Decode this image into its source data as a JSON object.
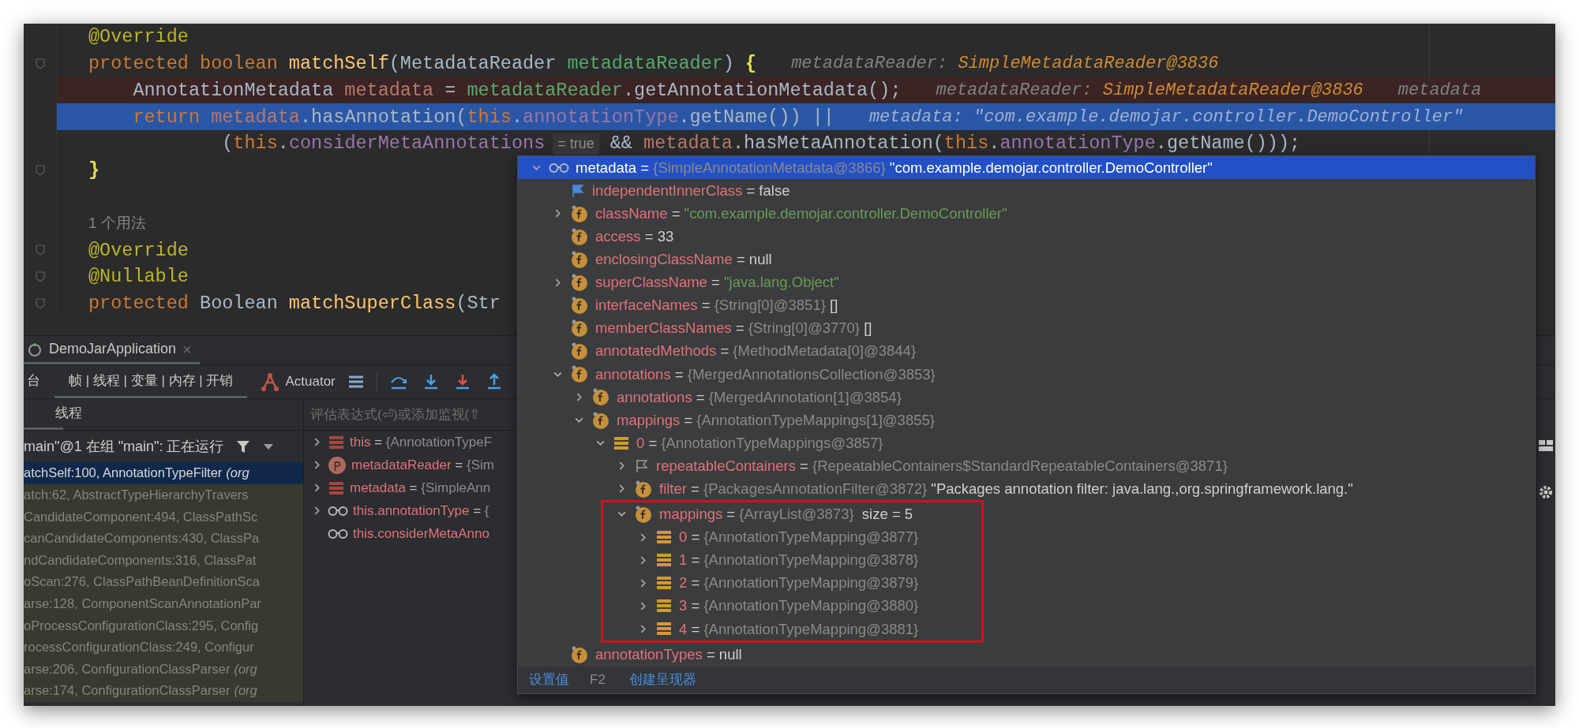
{
  "editor": {
    "lines": [
      {
        "kind": "normal",
        "items": [
          {
            "kind": "code",
            "tokens": [
              {
                "kind": "annotation",
                "text": "@Override"
              }
            ]
          }
        ]
      },
      {
        "kind": "normal",
        "fold_marker": true,
        "items": [
          {
            "kind": "code",
            "tokens": [
              {
                "kind": "keyword",
                "text": "protected boolean "
              },
              {
                "kind": "method",
                "text": "matchSelf"
              },
              {
                "kind": "plain",
                "text": "(MetadataReader "
              },
              {
                "kind": "param",
                "text": "metadataReader"
              },
              {
                "kind": "plain",
                "text": ") "
              },
              {
                "kind": "brace",
                "text": "{"
              }
            ]
          },
          {
            "kind": "hint",
            "tokens": [
              {
                "kind": "label",
                "text": "metadataReader: "
              },
              {
                "kind": "value",
                "text": "SimpleMetadataReader@3836"
              }
            ]
          }
        ]
      },
      {
        "kind": "breakpoint",
        "items": [
          {
            "kind": "code",
            "tokens": [
              {
                "kind": "plain",
                "text": "    AnnotationMetadata "
              },
              {
                "kind": "local",
                "text": "metadata"
              },
              {
                "kind": "plain",
                "text": " = "
              },
              {
                "kind": "param",
                "text": "metadataReader"
              },
              {
                "kind": "plain",
                "text": ".getAnnotationMetadata();"
              }
            ]
          },
          {
            "kind": "hint",
            "tokens": [
              {
                "kind": "label",
                "text": "metadataReader: "
              },
              {
                "kind": "value",
                "text": "SimpleMetadataReader@3836"
              }
            ]
          },
          {
            "kind": "hint",
            "tokens": [
              {
                "kind": "label",
                "text": "metadata"
              }
            ]
          }
        ]
      },
      {
        "kind": "current",
        "items": [
          {
            "kind": "code",
            "tokens": [
              {
                "kind": "keyword",
                "text": "    return "
              },
              {
                "kind": "local",
                "text": "metadata"
              },
              {
                "kind": "plain",
                "text": ".hasAnnotation("
              },
              {
                "kind": "keyword",
                "text": "this"
              },
              {
                "kind": "plain",
                "text": "."
              },
              {
                "kind": "field",
                "text": "annotationType"
              },
              {
                "kind": "plain",
                "text": ".getName()) ||"
              }
            ]
          },
          {
            "kind": "hint",
            "tokens": [
              {
                "kind": "label",
                "text": "metadata: \"com.example.demojar.controller.DemoController\""
              }
            ]
          }
        ]
      },
      {
        "kind": "normal",
        "items": [
          {
            "kind": "code",
            "tokens": [
              {
                "kind": "plain",
                "text": "            ("
              },
              {
                "kind": "keyword",
                "text": "this"
              },
              {
                "kind": "plain",
                "text": "."
              },
              {
                "kind": "field",
                "text": "considerMetaAnnotations"
              }
            ]
          },
          {
            "kind": "inlay",
            "text": "= true"
          },
          {
            "kind": "code",
            "tokens": [
              {
                "kind": "plain",
                "text": "&& "
              },
              {
                "kind": "local",
                "text": "metadata"
              },
              {
                "kind": "plain",
                "text": ".hasMetaAnnotation("
              },
              {
                "kind": "keyword",
                "text": "this"
              },
              {
                "kind": "plain",
                "text": "."
              },
              {
                "kind": "field",
                "text": "annotationType"
              },
              {
                "kind": "plain",
                "text": ".getName()));"
              }
            ]
          }
        ]
      },
      {
        "kind": "normal",
        "fold_marker": true,
        "items": [
          {
            "kind": "code",
            "tokens": [
              {
                "kind": "brace",
                "text": "}"
              }
            ]
          }
        ]
      },
      {
        "kind": "normal"
      },
      {
        "kind": "normal",
        "items": [
          {
            "kind": "usage",
            "text": "1 个用法"
          }
        ]
      },
      {
        "kind": "normal",
        "fold_marker": true,
        "items": [
          {
            "kind": "code",
            "tokens": [
              {
                "kind": "annotation",
                "text": "@Override"
              }
            ]
          }
        ]
      },
      {
        "kind": "normal",
        "fold_marker": true,
        "items": [
          {
            "kind": "code",
            "tokens": [
              {
                "kind": "annotation",
                "text": "@Nullable"
              }
            ]
          }
        ]
      },
      {
        "kind": "normal",
        "fold_marker": true,
        "items": [
          {
            "kind": "code",
            "tokens": [
              {
                "kind": "keyword",
                "text": "protected "
              },
              {
                "kind": "plain",
                "text": "Boolean "
              },
              {
                "kind": "method",
                "text": "matchSuperClass"
              },
              {
                "kind": "plain",
                "text": "(Str"
              }
            ]
          }
        ]
      }
    ]
  },
  "debug_panel": {
    "run_tab": {
      "label": "DemoJarApplication",
      "close": "×"
    },
    "toolbar_tabs": [
      {
        "label": "台",
        "selected": false
      },
      {
        "label": "帧 | 线程 | 变量 | 内存 | 开销",
        "selected": true
      }
    ],
    "actuator": "Actuator",
    "threads_tab": {
      "label": "线程",
      "selected": true
    },
    "thread_selector": "main\"@1 在组 \"main\": 正在运行",
    "frames": [
      {
        "text": "atchSelf:100, AnnotationTypeFilter *(org*",
        "selected": true
      },
      {
        "text": "atch:62, AbstractTypeHierarchyTravers",
        "selected": false
      },
      {
        "text": "CandidateComponent:494, ClassPathSc",
        "selected": false
      },
      {
        "text": "canCandidateComponents:430, ClassPa",
        "selected": false
      },
      {
        "text": "ndCandidateComponents:316, ClassPat",
        "selected": false
      },
      {
        "text": "oScan:276, ClassPathBeanDefinitionSca",
        "selected": false
      },
      {
        "text": "arse:128, ComponentScanAnnotationPar",
        "selected": false
      },
      {
        "text": "oProcessConfigurationClass:295, Config",
        "selected": false
      },
      {
        "text": "rocessConfigurationClass:249, Configur",
        "selected": false
      },
      {
        "text": "arse:206, ConfigurationClassParser *(org*",
        "selected": false
      },
      {
        "text": "arse:174, ConfigurationClassParser *(org*",
        "selected": false
      }
    ],
    "evaluate": {
      "placeholder": "评估表达式(⏎)或添加监视(⇧"
    },
    "variables": [
      {
        "kind": "object",
        "name": "this",
        "value": [
          {
            "kind": "plain",
            "text": " = "
          },
          {
            "kind": "ref",
            "text": "{AnnotationTypeF"
          }
        ],
        "expanded": false
      },
      {
        "kind": "param",
        "name": "metadataReader",
        "value": [
          {
            "kind": "plain",
            "text": " = "
          },
          {
            "kind": "ref",
            "text": "{Sim"
          }
        ],
        "expanded": false
      },
      {
        "kind": "object",
        "name": "metadata",
        "value": [
          {
            "kind": "plain",
            "text": " = "
          },
          {
            "kind": "ref",
            "text": "{SimpleAnn"
          }
        ],
        "expanded": false
      },
      {
        "kind": "watch",
        "name": "this.annotationType",
        "value": [
          {
            "kind": "plain",
            "text": " = "
          },
          {
            "kind": "ref",
            "text": "{"
          }
        ],
        "expanded": false
      },
      {
        "kind": "watch",
        "name": "this.considerMetaAnno"
      }
    ]
  },
  "popup": {
    "root": {
      "kind": "watch",
      "name": "metadata",
      "value": [
        {
          "kind": "plain",
          "text": " = "
        },
        {
          "kind": "ref",
          "text": "{SimpleAnnotationMetadata@3866}"
        },
        {
          "kind": "plain",
          "text": " \"com.example.demojar.controller.DemoController\""
        }
      ],
      "expanded": true,
      "selected": true,
      "children": [
        {
          "kind": "flag",
          "name": "independentInnerClass",
          "value": [
            {
              "kind": "plain",
              "text": " = false"
            }
          ],
          "selected": false
        },
        {
          "kind": "field",
          "name": "className",
          "value": [
            {
              "kind": "plain",
              "text": " = "
            },
            {
              "kind": "string",
              "text": "\"com.example.demojar.controller.DemoController\""
            }
          ],
          "expanded": false,
          "selected": false
        },
        {
          "kind": "field",
          "name": "access",
          "value": [
            {
              "kind": "plain",
              "text": " = 33"
            }
          ],
          "selected": false
        },
        {
          "kind": "field",
          "name": "enclosingClassName",
          "value": [
            {
              "kind": "plain",
              "text": " = null"
            }
          ],
          "selected": false
        },
        {
          "kind": "field",
          "name": "superClassName",
          "value": [
            {
              "kind": "plain",
              "text": " = "
            },
            {
              "kind": "string",
              "text": "\"java.lang.Object\""
            }
          ],
          "expanded": false,
          "selected": false
        },
        {
          "kind": "field",
          "name": "interfaceNames",
          "value": [
            {
              "kind": "plain",
              "text": " = "
            },
            {
              "kind": "ref",
              "text": "{String[0]@3851}"
            },
            {
              "kind": "plain",
              "text": " []"
            }
          ],
          "selected": false
        },
        {
          "kind": "field",
          "name": "memberClassNames",
          "value": [
            {
              "kind": "plain",
              "text": " = "
            },
            {
              "kind": "ref",
              "text": "{String[0]@3770}"
            },
            {
              "kind": "plain",
              "text": " []"
            }
          ],
          "selected": false
        },
        {
          "kind": "field",
          "name": "annotatedMethods",
          "value": [
            {
              "kind": "plain",
              "text": " = "
            },
            {
              "kind": "ref",
              "text": "{MethodMetadata[0]@3844}"
            }
          ],
          "selected": false
        },
        {
          "kind": "field",
          "name": "annotations",
          "value": [
            {
              "kind": "plain",
              "text": " = "
            },
            {
              "kind": "ref",
              "text": "{MergedAnnotationsCollection@3853}"
            }
          ],
          "expanded": true,
          "selected": false,
          "children": [
            {
              "kind": "field",
              "name": "annotations",
              "value": [
                {
                  "kind": "plain",
                  "text": " = "
                },
                {
                  "kind": "ref",
                  "text": "{MergedAnnotation[1]@3854}"
                }
              ],
              "expanded": false,
              "selected": false
            },
            {
              "kind": "field",
              "name": "mappings",
              "value": [
                {
                  "kind": "plain",
                  "text": " = "
                },
                {
                  "kind": "ref",
                  "text": "{AnnotationTypeMappings[1]@3855}"
                }
              ],
              "expanded": true,
              "selected": false,
              "children": [
                {
                  "kind": "array",
                  "name": "0",
                  "value": [
                    {
                      "kind": "plain",
                      "text": " = "
                    },
                    {
                      "kind": "ref",
                      "text": "{AnnotationTypeMappings@3857}"
                    }
                  ],
                  "expanded": true,
                  "selected": false,
                  "children": [
                    {
                      "kind": "flag_outline",
                      "name": "repeatableContainers",
                      "value": [
                        {
                          "kind": "plain",
                          "text": " = "
                        },
                        {
                          "kind": "ref",
                          "text": "{RepeatableContainers$StandardRepeatableContainers@3871}"
                        }
                      ],
                      "expanded": false,
                      "selected": false
                    },
                    {
                      "kind": "field",
                      "name": "filter",
                      "value": [
                        {
                          "kind": "plain",
                          "text": " = "
                        },
                        {
                          "kind": "ref",
                          "text": "{PackagesAnnotationFilter@3872}"
                        },
                        {
                          "kind": "plain",
                          "text": " \"Packages annotation filter: java.lang.,org.springframework.lang.\""
                        }
                      ],
                      "expanded": false,
                      "selected": false
                    },
                    {
                      "kind": "field",
                      "name": "mappings",
                      "value": [
                        {
                          "kind": "plain",
                          "text": " = "
                        },
                        {
                          "kind": "ref",
                          "text": "{ArrayList@3873}"
                        },
                        {
                          "kind": "plain",
                          "text": "  size = 5"
                        }
                      ],
                      "expanded": true,
                      "selected": false,
                      "highlighted": true,
                      "children": [
                        {
                          "kind": "array",
                          "name": "0",
                          "value": [
                            {
                              "kind": "plain",
                              "text": " = "
                            },
                            {
                              "kind": "ref",
                              "text": "{AnnotationTypeMapping@3877}"
                            }
                          ],
                          "expanded": false,
                          "selected": false
                        },
                        {
                          "kind": "array",
                          "name": "1",
                          "value": [
                            {
                              "kind": "plain",
                              "text": " = "
                            },
                            {
                              "kind": "ref",
                              "text": "{AnnotationTypeMapping@3878}"
                            }
                          ],
                          "expanded": false,
                          "selected": false
                        },
                        {
                          "kind": "array",
                          "name": "2",
                          "value": [
                            {
                              "kind": "plain",
                              "text": " = "
                            },
                            {
                              "kind": "ref",
                              "text": "{AnnotationTypeMapping@3879}"
                            }
                          ],
                          "expanded": false,
                          "selected": false
                        },
                        {
                          "kind": "array",
                          "name": "3",
                          "value": [
                            {
                              "kind": "plain",
                              "text": " = "
                            },
                            {
                              "kind": "ref",
                              "text": "{AnnotationTypeMapping@3880}"
                            }
                          ],
                          "expanded": false,
                          "selected": false
                        },
                        {
                          "kind": "array",
                          "name": "4",
                          "value": [
                            {
                              "kind": "plain",
                              "text": " = "
                            },
                            {
                              "kind": "ref",
                              "text": "{AnnotationTypeMapping@3881}"
                            }
                          ],
                          "expanded": false,
                          "selected": false
                        }
                      ]
                    }
                  ]
                }
              ]
            }
          ]
        },
        {
          "kind": "field",
          "name": "annotationTypes",
          "value": [
            {
              "kind": "plain",
              "text": " = null"
            }
          ],
          "selected": false
        }
      ]
    },
    "footer": [
      {
        "label": "设置值",
        "shortcut": "F2"
      },
      {
        "label": "创建呈现器"
      }
    ]
  }
}
